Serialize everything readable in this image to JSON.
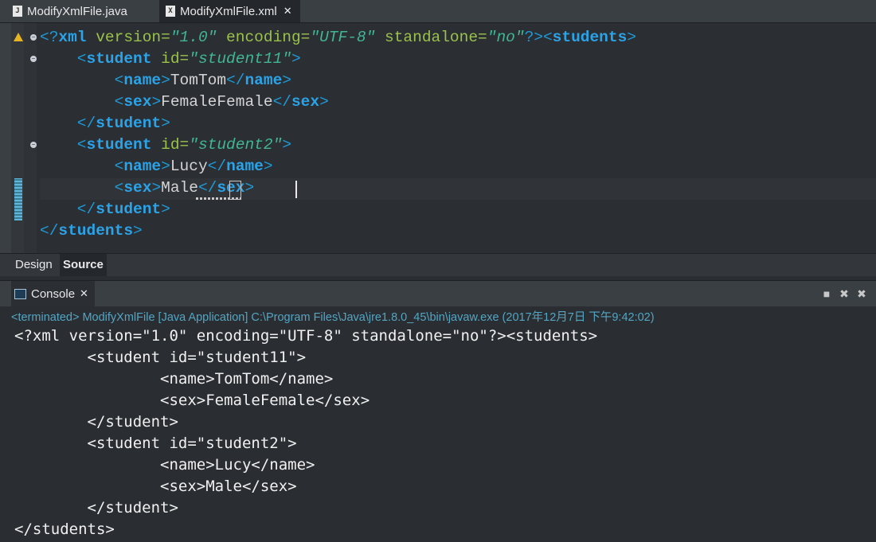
{
  "tabs": [
    {
      "label": "ModifyXmlFile.java",
      "icon": "java-file-icon",
      "glyph": "J",
      "active": false
    },
    {
      "label": "ModifyXmlFile.xml",
      "icon": "xml-file-icon",
      "glyph": "X",
      "active": true
    }
  ],
  "editor": {
    "lines": [
      [
        [
          "<?",
          "t-punc"
        ],
        [
          "xml",
          "t-tag"
        ],
        [
          " version=",
          "t-attr"
        ],
        [
          "\"1.0\"",
          "t-val"
        ],
        [
          " encoding=",
          "t-attr"
        ],
        [
          "\"UTF-8\"",
          "t-val"
        ],
        [
          " standalone=",
          "t-attr"
        ],
        [
          "\"no\"",
          "t-val"
        ],
        [
          "?><",
          "t-punc"
        ],
        [
          "students",
          "t-tag"
        ],
        [
          ">",
          "t-punc"
        ]
      ],
      [
        [
          "    <",
          "t-punc"
        ],
        [
          "student",
          "t-tag"
        ],
        [
          " id=",
          "t-attr"
        ],
        [
          "\"student11\"",
          "t-val"
        ],
        [
          ">",
          "t-punc"
        ]
      ],
      [
        [
          "        <",
          "t-punc"
        ],
        [
          "name",
          "t-tag"
        ],
        [
          ">",
          "t-punc"
        ],
        [
          "TomTom",
          "t-text"
        ],
        [
          "</",
          "t-punc"
        ],
        [
          "name",
          "t-tag"
        ],
        [
          ">",
          "t-punc"
        ]
      ],
      [
        [
          "        <",
          "t-punc"
        ],
        [
          "sex",
          "t-tag"
        ],
        [
          ">",
          "t-punc"
        ],
        [
          "FemaleFemale",
          "t-text"
        ],
        [
          "</",
          "t-punc"
        ],
        [
          "sex",
          "t-tag"
        ],
        [
          ">",
          "t-punc"
        ]
      ],
      [
        [
          "    </",
          "t-punc"
        ],
        [
          "student",
          "t-tag"
        ],
        [
          ">",
          "t-punc"
        ]
      ],
      [
        [
          "    <",
          "t-punc"
        ],
        [
          "student",
          "t-tag"
        ],
        [
          " id=",
          "t-attr"
        ],
        [
          "\"student2\"",
          "t-val"
        ],
        [
          ">",
          "t-punc"
        ]
      ],
      [
        [
          "        <",
          "t-punc"
        ],
        [
          "name",
          "t-tag"
        ],
        [
          ">",
          "t-punc"
        ],
        [
          "Lucy",
          "t-text"
        ],
        [
          "</",
          "t-punc"
        ],
        [
          "name",
          "t-tag"
        ],
        [
          ">",
          "t-punc"
        ]
      ],
      [
        [
          "        <",
          "t-punc"
        ],
        [
          "sex",
          "t-tag"
        ],
        [
          ">",
          "t-punc"
        ],
        [
          "Male",
          "t-text"
        ],
        [
          "</",
          "t-punc"
        ],
        [
          "sex",
          "t-tag"
        ],
        [
          ">",
          "t-punc"
        ]
      ],
      [
        [
          "    </",
          "t-punc"
        ],
        [
          "student",
          "t-tag"
        ],
        [
          ">",
          "t-punc"
        ]
      ],
      [
        [
          "</",
          "t-punc"
        ],
        [
          "students",
          "t-tag"
        ],
        [
          ">",
          "t-punc"
        ]
      ]
    ]
  },
  "editor_tabs": {
    "design": "Design",
    "source": "Source"
  },
  "console": {
    "title": "Console",
    "status": "<terminated> ModifyXmlFile [Java Application] C:\\Program Files\\Java\\jre1.8.0_45\\bin\\javaw.exe (2017年12月7日 下午9:42:02)",
    "output": [
      "<?xml version=\"1.0\" encoding=\"UTF-8\" standalone=\"no\"?><students>",
      "\t<student id=\"student11\">",
      "\t\t<name>TomTom</name>",
      "\t\t<sex>FemaleFemale</sex>",
      "\t</student>",
      "\t<student id=\"student2\">",
      "\t\t<name>Lucy</name>",
      "\t\t<sex>Male</sex>",
      "\t</student>",
      "</students>"
    ]
  },
  "colors": {
    "tag": "#2ba3e8",
    "attribute": "#9ac24a",
    "value": "#41b596",
    "status": "#52a6c4"
  }
}
